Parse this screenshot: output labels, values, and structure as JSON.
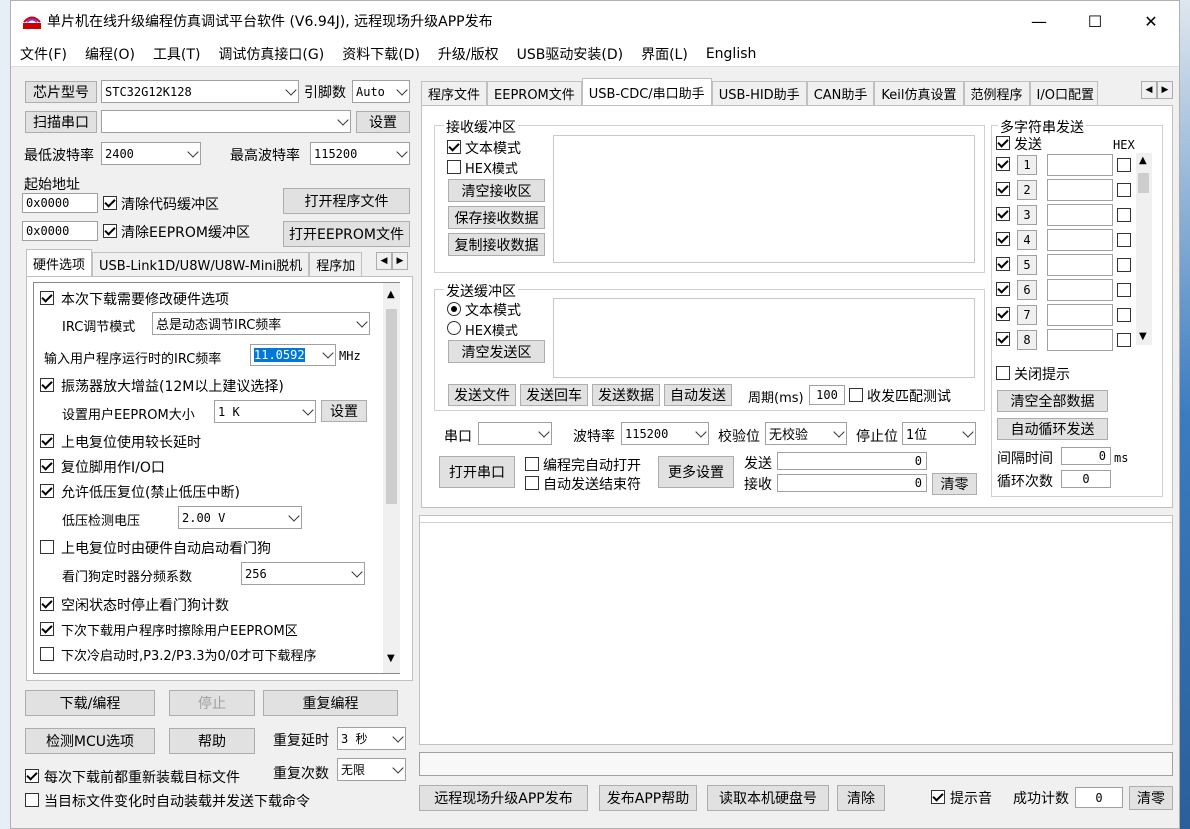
{
  "window": {
    "title": "单片机在线升级编程仿真调试平台软件 (V6.94J), 远程现场升级APP发布",
    "minimize": "—",
    "maximize": "☐",
    "close": "✕"
  },
  "menu": [
    "文件(F)",
    "编程(O)",
    "工具(T)",
    "调试仿真接口(G)",
    "资料下载(D)",
    "升级/版权",
    "USB驱动安装(D)",
    "界面(L)",
    "English"
  ],
  "left": {
    "chip_type_btn": "芯片型号",
    "chip_type": "STC32G12K128",
    "pins_label": "引脚数",
    "pins": "Auto",
    "scan_port_btn": "扫描串口",
    "port": "",
    "settings_btn": "设置",
    "min_baud_label": "最低波特率",
    "min_baud": "2400",
    "max_baud_label": "最高波特率",
    "max_baud": "115200",
    "start_addr_label": "起始地址",
    "addr1": "0x0000",
    "clear_code": "清除代码缓冲区",
    "open_prog": "打开程序文件",
    "addr2": "0x0000",
    "clear_eeprom": "清除EEPROM缓冲区",
    "open_eeprom": "打开EEPROM文件",
    "tabs": [
      "硬件选项",
      "USB-Link1D/U8W/U8W-Mini脱机",
      "程序加"
    ],
    "options": {
      "opt1": "本次下载需要修改硬件选项",
      "irc_mode_label": "IRC调节模式",
      "irc_mode": "总是动态调节IRC频率",
      "irc_freq_label": "输入用户程序运行时的IRC频率",
      "irc_freq": "11.0592",
      "mhz": "MHz",
      "opt2": "振荡器放大增益(12M以上建议选择)",
      "eeprom_size_label": "设置用户EEPROM大小",
      "eeprom_size": "1  K",
      "eeprom_set": "设置",
      "opt3": "上电复位使用较长延时",
      "opt4": "复位脚用作I/O口",
      "opt5": "允许低压复位(禁止低压中断)",
      "lvd_label": "低压检测电压",
      "lvd": "2.00 V",
      "opt6": "上电复位时由硬件自动启动看门狗",
      "wdt_label": "看门狗定时器分频系数",
      "wdt": "256",
      "opt7": "空闲状态时停止看门狗计数",
      "opt8": "下次下载用户程序时擦除用户EEPROM区",
      "opt9": "下次冷启动时,P3.2/P3.3为0/0才可下载程序"
    },
    "download_btn": "下载/编程",
    "stop_btn": "停止",
    "reprog_btn": "重复编程",
    "detect_btn": "检测MCU选项",
    "help_btn": "帮助",
    "repeat_delay_label": "重复延时",
    "repeat_delay": "3 秒",
    "reload_chk": "每次下载前都重新装载目标文件",
    "repeat_count_label": "重复次数",
    "repeat_count": "无限",
    "auto_chk": "当目标文件变化时自动装载并发送下载命令"
  },
  "right": {
    "tabs": [
      "程序文件",
      "EEPROM文件",
      "USB-CDC/串口助手",
      "USB-HID助手",
      "CAN助手",
      "Keil仿真设置",
      "范例程序",
      "I/O口配置"
    ],
    "recv": {
      "title": "接收缓冲区",
      "text_mode": "文本模式",
      "hex_mode": "HEX模式",
      "clear": "清空接收区",
      "save": "保存接收数据",
      "copy": "复制接收数据"
    },
    "send": {
      "title": "发送缓冲区",
      "text_mode": "文本模式",
      "hex_mode": "HEX模式",
      "clear": "清空发送区",
      "send_file": "发送文件",
      "send_cr": "发送回车",
      "send_data": "发送数据",
      "auto_send": "自动发送",
      "period_label": "周期(ms)",
      "period": "100",
      "match_test": "收发匹配测试"
    },
    "port_label": "串口",
    "port": "",
    "baud_label": "波特率",
    "baud": "115200",
    "parity_label": "校验位",
    "parity": "无校验",
    "stop_label": "停止位",
    "stop": "1位",
    "open_port": "打开串口",
    "auto_open": "编程完自动打开",
    "auto_close": "自动发送结束符",
    "more": "更多设置",
    "tx_label": "发送",
    "tx": "0",
    "rx_label": "接收",
    "rx": "0",
    "clear_counts": "清零",
    "multi": {
      "title": "多字符串发送",
      "send": "发送",
      "hex": "HEX",
      "items": [
        "1",
        "2",
        "3",
        "4",
        "5",
        "6",
        "7",
        "8"
      ],
      "close_tip": "关闭提示",
      "clear_all": "清空全部数据",
      "auto_loop": "自动循环发送",
      "interval_label": "间隔时间",
      "interval": "0",
      "ms": "ms",
      "loop_label": "循环次数",
      "loop": "0"
    },
    "bottom": {
      "remote": "远程现场升级APP发布",
      "publish_help": "发布APP帮助",
      "read_disk": "读取本机硬盘号",
      "clear": "清除",
      "beep": "提示音",
      "success_label": "成功计数",
      "success": "0",
      "reset": "清零"
    }
  }
}
